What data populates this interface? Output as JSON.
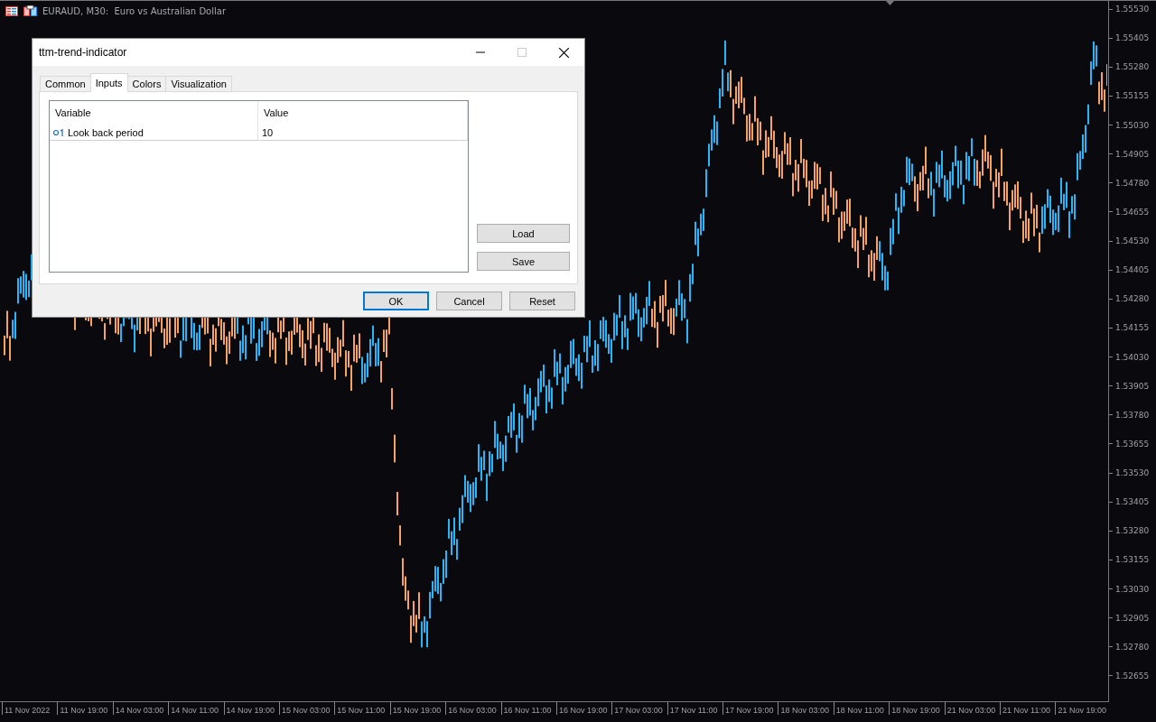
{
  "chart": {
    "title": "EURAUD, M30:  Euro vs Australian Dollar",
    "price_labels": [
      "1.55530",
      "1.55405",
      "1.55280",
      "1.55155",
      "1.55030",
      "1.54905",
      "1.54780",
      "1.54655",
      "1.54530",
      "1.54405",
      "1.54280",
      "1.54155",
      "1.54030",
      "1.53905",
      "1.53780",
      "1.53655",
      "1.53530",
      "1.53405",
      "1.53280",
      "1.53155",
      "1.53030",
      "1.52905",
      "1.52780",
      "1.52655"
    ],
    "time_labels": [
      "11 Nov 2022",
      "11 Nov 19:00",
      "14 Nov 03:00",
      "14 Nov 11:00",
      "14 Nov 19:00",
      "15 Nov 03:00",
      "15 Nov 11:00",
      "15 Nov 19:00",
      "16 Nov 03:00",
      "16 Nov 11:00",
      "16 Nov 19:00",
      "17 Nov 03:00",
      "17 Nov 11:00",
      "17 Nov 19:00",
      "18 Nov 03:00",
      "18 Nov 11:00",
      "18 Nov 19:00",
      "21 Nov 03:00",
      "21 Nov 11:00",
      "21 Nov 19:00"
    ]
  },
  "dialog": {
    "title": "ttm-trend-indicator",
    "tabs": [
      {
        "label": "Common",
        "selected": false
      },
      {
        "label": "Inputs",
        "selected": true
      },
      {
        "label": "Colors",
        "selected": false
      },
      {
        "label": "Visualization",
        "selected": false
      }
    ],
    "table": {
      "columns": [
        "Variable",
        "Value"
      ],
      "rows": [
        {
          "variable": "Look back period",
          "value": "10"
        }
      ]
    },
    "side_buttons": [
      "Load",
      "Save"
    ],
    "buttons": [
      {
        "label": "OK",
        "focused": true
      },
      {
        "label": "Cancel",
        "focused": false
      },
      {
        "label": "Reset",
        "focused": false
      }
    ]
  }
}
